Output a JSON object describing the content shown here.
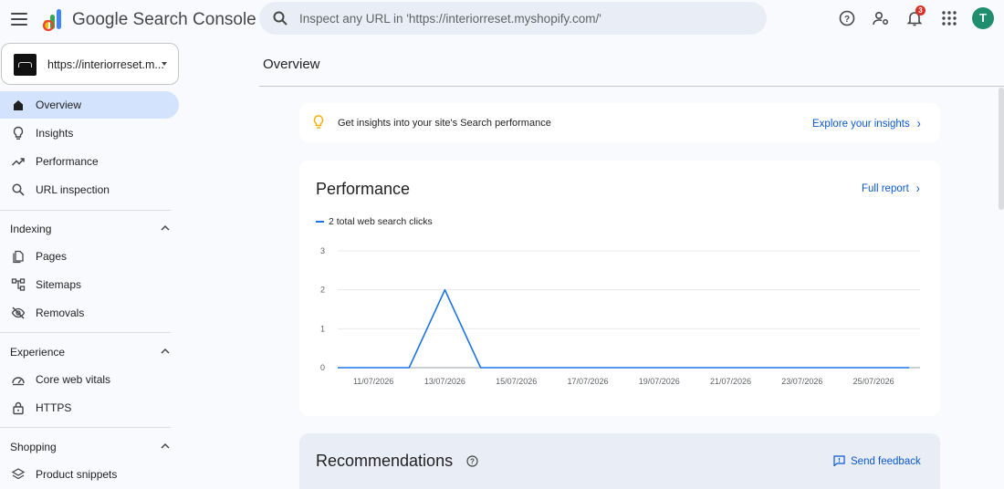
{
  "app": {
    "title": "Google Search Console"
  },
  "search": {
    "placeholder": "Inspect any URL in 'https://interiorreset.myshopify.com/'"
  },
  "header": {
    "notification_count": "3",
    "avatar_initial": "T"
  },
  "property": {
    "label": "https://interiorreset.m..."
  },
  "sidebar": {
    "top_items": [
      {
        "label": "Overview",
        "icon": "home-icon",
        "active": true
      },
      {
        "label": "Insights",
        "icon": "lightbulb-icon"
      },
      {
        "label": "Performance",
        "icon": "trending-up-icon"
      },
      {
        "label": "URL inspection",
        "icon": "search-icon"
      }
    ],
    "sections": [
      {
        "label": "Indexing",
        "items": [
          {
            "label": "Pages",
            "icon": "pages-icon"
          },
          {
            "label": "Sitemaps",
            "icon": "sitemap-icon"
          },
          {
            "label": "Removals",
            "icon": "eye-off-icon"
          }
        ]
      },
      {
        "label": "Experience",
        "items": [
          {
            "label": "Core web vitals",
            "icon": "gauge-icon"
          },
          {
            "label": "HTTPS",
            "icon": "lock-icon"
          }
        ]
      },
      {
        "label": "Shopping",
        "items": [
          {
            "label": "Product snippets",
            "icon": "layers-icon"
          }
        ]
      }
    ]
  },
  "main": {
    "page_title": "Overview",
    "insights_banner": {
      "text": "Get insights into your site's Search performance",
      "link": "Explore your insights"
    },
    "performance": {
      "title": "Performance",
      "link": "Full report",
      "legend": "2 total web search clicks"
    },
    "recommendations": {
      "title": "Recommendations",
      "feedback": "Send feedback"
    }
  },
  "colors": {
    "accent": "#0b57d0",
    "active_nav": "#d3e3fd",
    "line": "#1a73e8",
    "avatar": "#1e8e6e",
    "badge": "#d93025"
  },
  "chart_data": {
    "type": "line",
    "title": "",
    "xlabel": "",
    "ylabel": "",
    "ylim": [
      0,
      3
    ],
    "yticks": [
      "0",
      "1",
      "2",
      "3"
    ],
    "xtick_labels": [
      "11/07/2026",
      "13/07/2026",
      "15/07/2026",
      "17/07/2026",
      "19/07/2026",
      "21/07/2026",
      "23/07/2026",
      "25/07/2026"
    ],
    "x": [
      "10/07/2026",
      "11/07/2026",
      "12/07/2026",
      "13/07/2026",
      "14/07/2026",
      "15/07/2026",
      "16/07/2026",
      "17/07/2026",
      "18/07/2026",
      "19/07/2026",
      "20/07/2026",
      "21/07/2026",
      "22/07/2026",
      "23/07/2026",
      "24/07/2026",
      "25/07/2026",
      "26/07/2026"
    ],
    "series": [
      {
        "name": "2 total web search clicks",
        "values": [
          0,
          0,
          0,
          2,
          0,
          0,
          0,
          0,
          0,
          0,
          0,
          0,
          0,
          0,
          0,
          0,
          0
        ]
      }
    ],
    "grid": true,
    "legend": "top-left"
  }
}
